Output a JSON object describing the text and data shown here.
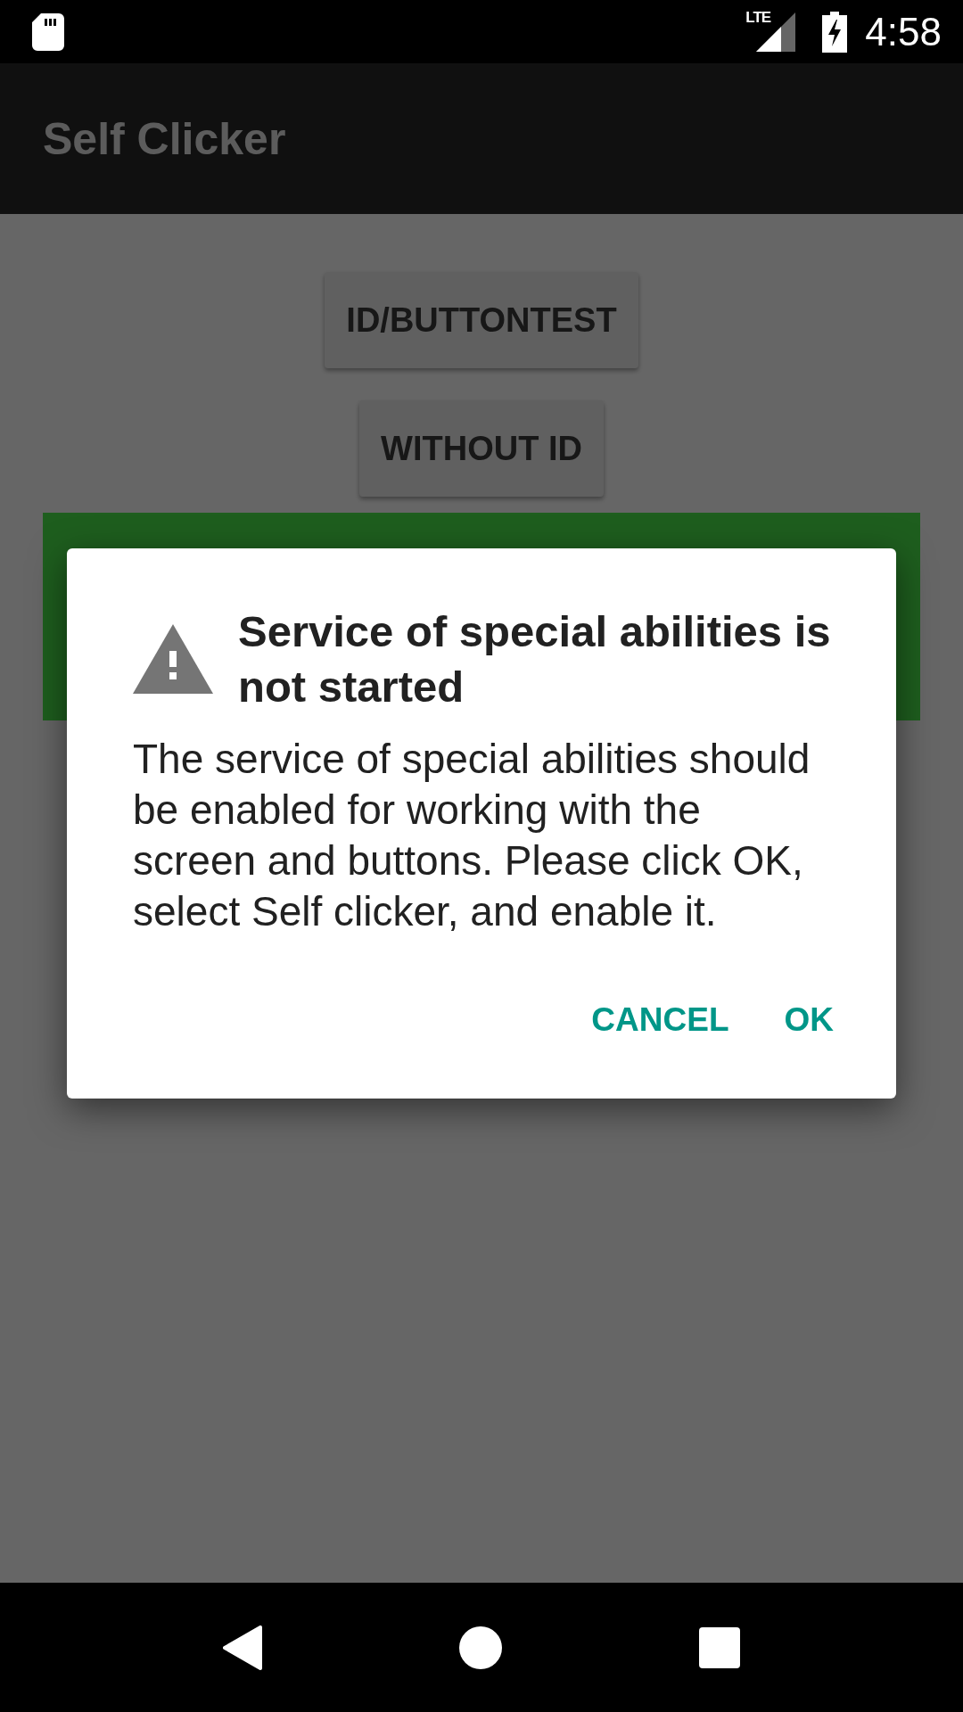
{
  "status_bar": {
    "network_type": "LTE",
    "time": "4:58"
  },
  "app_bar": {
    "title": "Self Clicker"
  },
  "buttons": [
    "ID/BUTTONTEST",
    "WITHOUT ID"
  ],
  "dialog": {
    "title": "Service of special abilities is not started",
    "message": "The service of special abilities should be enabled for working with the screen and buttons. Please click OK, select Self clicker, and enable it.",
    "actions": [
      "CANCEL",
      "OK"
    ]
  }
}
